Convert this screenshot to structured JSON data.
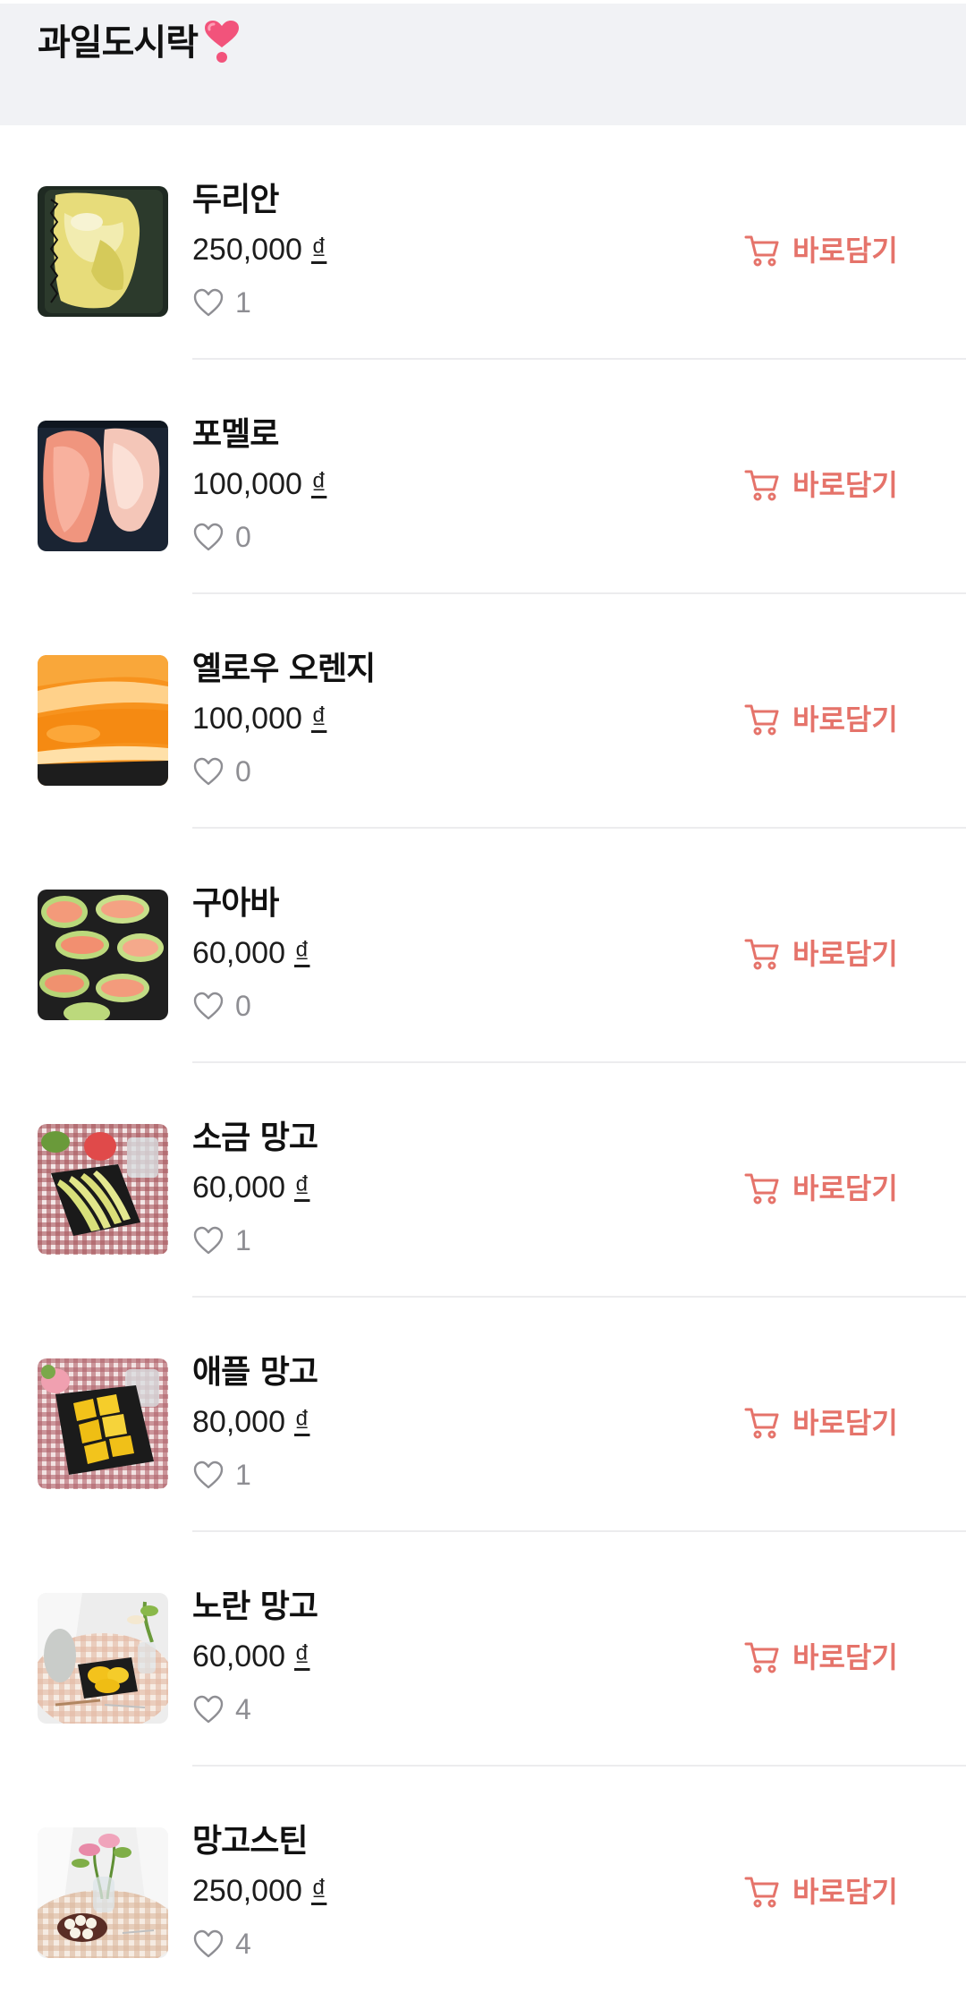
{
  "header": {
    "title": "과일도시락",
    "title_icon": "heart-emoji",
    "background": "#f1f2f5"
  },
  "colors": {
    "accent": "#e5736a",
    "muted": "#8e8e93"
  },
  "currency_symbol": "₫",
  "cart_label": "바로담기",
  "products": [
    {
      "name": "두리안",
      "price": "250,000",
      "likes": "1",
      "image": "durian-photo"
    },
    {
      "name": "포멜로",
      "price": "100,000",
      "likes": "0",
      "image": "pomelo-photo"
    },
    {
      "name": "옐로우 오렌지",
      "price": "100,000",
      "likes": "0",
      "image": "orange-photo"
    },
    {
      "name": "구아바",
      "price": "60,000",
      "likes": "0",
      "image": "guava-photo"
    },
    {
      "name": "소금 망고",
      "price": "60,000",
      "likes": "1",
      "image": "salt-mango-photo"
    },
    {
      "name": "애플 망고",
      "price": "80,000",
      "likes": "1",
      "image": "apple-mango-photo"
    },
    {
      "name": "노란 망고",
      "price": "60,000",
      "likes": "4",
      "image": "yellow-mango-photo"
    },
    {
      "name": "망고스틴",
      "price": "250,000",
      "likes": "4",
      "image": "mangosteen-photo"
    }
  ]
}
